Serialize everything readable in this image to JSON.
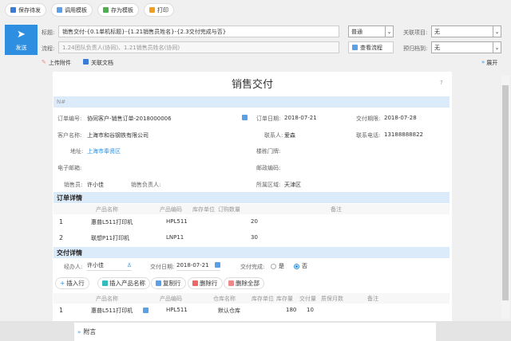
{
  "toolbar": {
    "save_draft": "保存待发",
    "call_template": "调用模板",
    "save_template": "存为模板",
    "print": "打印"
  },
  "header": {
    "send": "发送",
    "title_label": "标题:",
    "title_value": "销售交付-{0.1单机标题}-{1.21销售员姓名}-{2.3交付完成与否}",
    "priority": "普通",
    "related_project_label": "关联项目:",
    "related_project": "无",
    "flow_label": "流程:",
    "flow_placeholder": "1.24团队负责人(协同)、1.21销售员姓名(协同)",
    "view_flow": "查看流程",
    "archive_label": "预归档到:",
    "archive": "无",
    "upload": "上传附件",
    "related_doc": "关联文档",
    "expand": "展开"
  },
  "form": {
    "title": "销售交付",
    "help": "?",
    "no_label": "N#",
    "order_no_label": "订单编号:",
    "order_no": "协同客户-销售订单-2018000006",
    "order_date_label": "订单日期:",
    "order_date": "2018-07-21",
    "delivery_deadline_label": "交付期限:",
    "delivery_deadline": "2018-07-28",
    "customer_label": "客户名称:",
    "customer": "上海市和谷钢铁有限公司",
    "contact_label": "联系人:",
    "contact": "爱森",
    "phone_label": "联系电话:",
    "phone": "13188888822",
    "address_label": "地址:",
    "address": "上海市奉贤区",
    "building_label": "楼栋门牌:",
    "email_label": "电子邮箱:",
    "zip_label": "邮政编码:",
    "sales_label": "销售员:",
    "sales": "许小佳",
    "sales_lead_label": "销售负责人:",
    "region_label": "所属区域:",
    "region": "天津区"
  },
  "order_details": {
    "title": "订单详情",
    "columns": [
      "产品名称",
      "产品编码",
      "库存单位",
      "订购数量",
      "备注"
    ],
    "rows": [
      {
        "n": "1",
        "name": "惠普L511打印机",
        "code": "HPL511",
        "qty": "20"
      },
      {
        "n": "2",
        "name": "联想P11打印机",
        "code": "LNP11",
        "qty": "30"
      }
    ]
  },
  "delivery": {
    "title": "交付详情",
    "handler_label": "经办人:",
    "handler": "许小佳",
    "date_label": "交付日期:",
    "date": "2018-07-21",
    "done_label": "交付完成:",
    "yes": "是",
    "no": "否",
    "selected": "否",
    "buttons": [
      "插入行",
      "插入产品名称",
      "复制行",
      "删除行",
      "删除全部"
    ],
    "columns": [
      "产品名称",
      "产品编码",
      "仓库名称",
      "库存单位",
      "库存量",
      "交付量",
      "质保月数",
      "备注"
    ],
    "rows": [
      {
        "n": "1",
        "name": "惠普L511打印机",
        "code": "HPL511",
        "warehouse": "默认仓库",
        "stock": "180",
        "qty": "10"
      }
    ]
  },
  "footer": {
    "note": "附言"
  },
  "colors": {
    "accent": "#2e8fe0",
    "band": "#dcebf9"
  }
}
